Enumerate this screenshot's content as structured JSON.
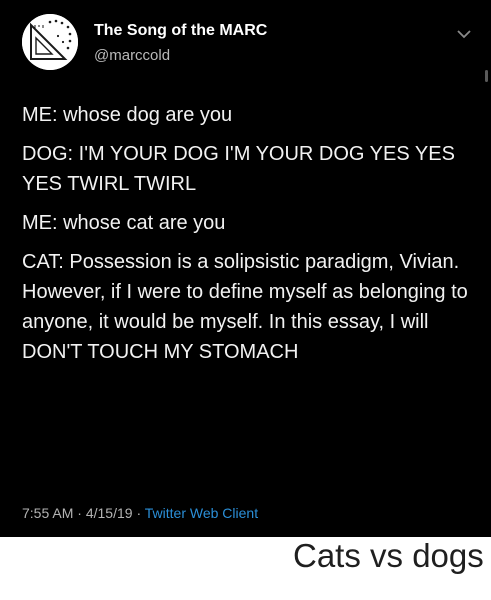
{
  "tweet": {
    "display_name": "The Song of the MARC",
    "handle": "@marccold",
    "paragraphs": [
      "ME: whose dog are you",
      "DOG: I'M YOUR DOG I'M YOUR DOG YES YES YES TWIRL TWIRL",
      "ME: whose cat are you",
      "CAT: Possession is a solipsistic paradigm, Vivian. However, if I were to define myself as belonging to anyone, it would be myself. In this essay, I will DON'T TOUCH MY STOMACH"
    ],
    "time": "7:55 AM",
    "date": "4/15/19",
    "separator": "·",
    "client": "Twitter Web Client",
    "icons": {
      "avatar": "triangle-ruler-logo",
      "menu": "chevron-down-icon"
    }
  },
  "caption": "Cats vs dogs",
  "colors": {
    "tweet_background": "#000000",
    "text": "#f2f2f2",
    "muted": "#b3b3b3",
    "link": "#2b8fd8",
    "page_background": "#ffffff"
  }
}
